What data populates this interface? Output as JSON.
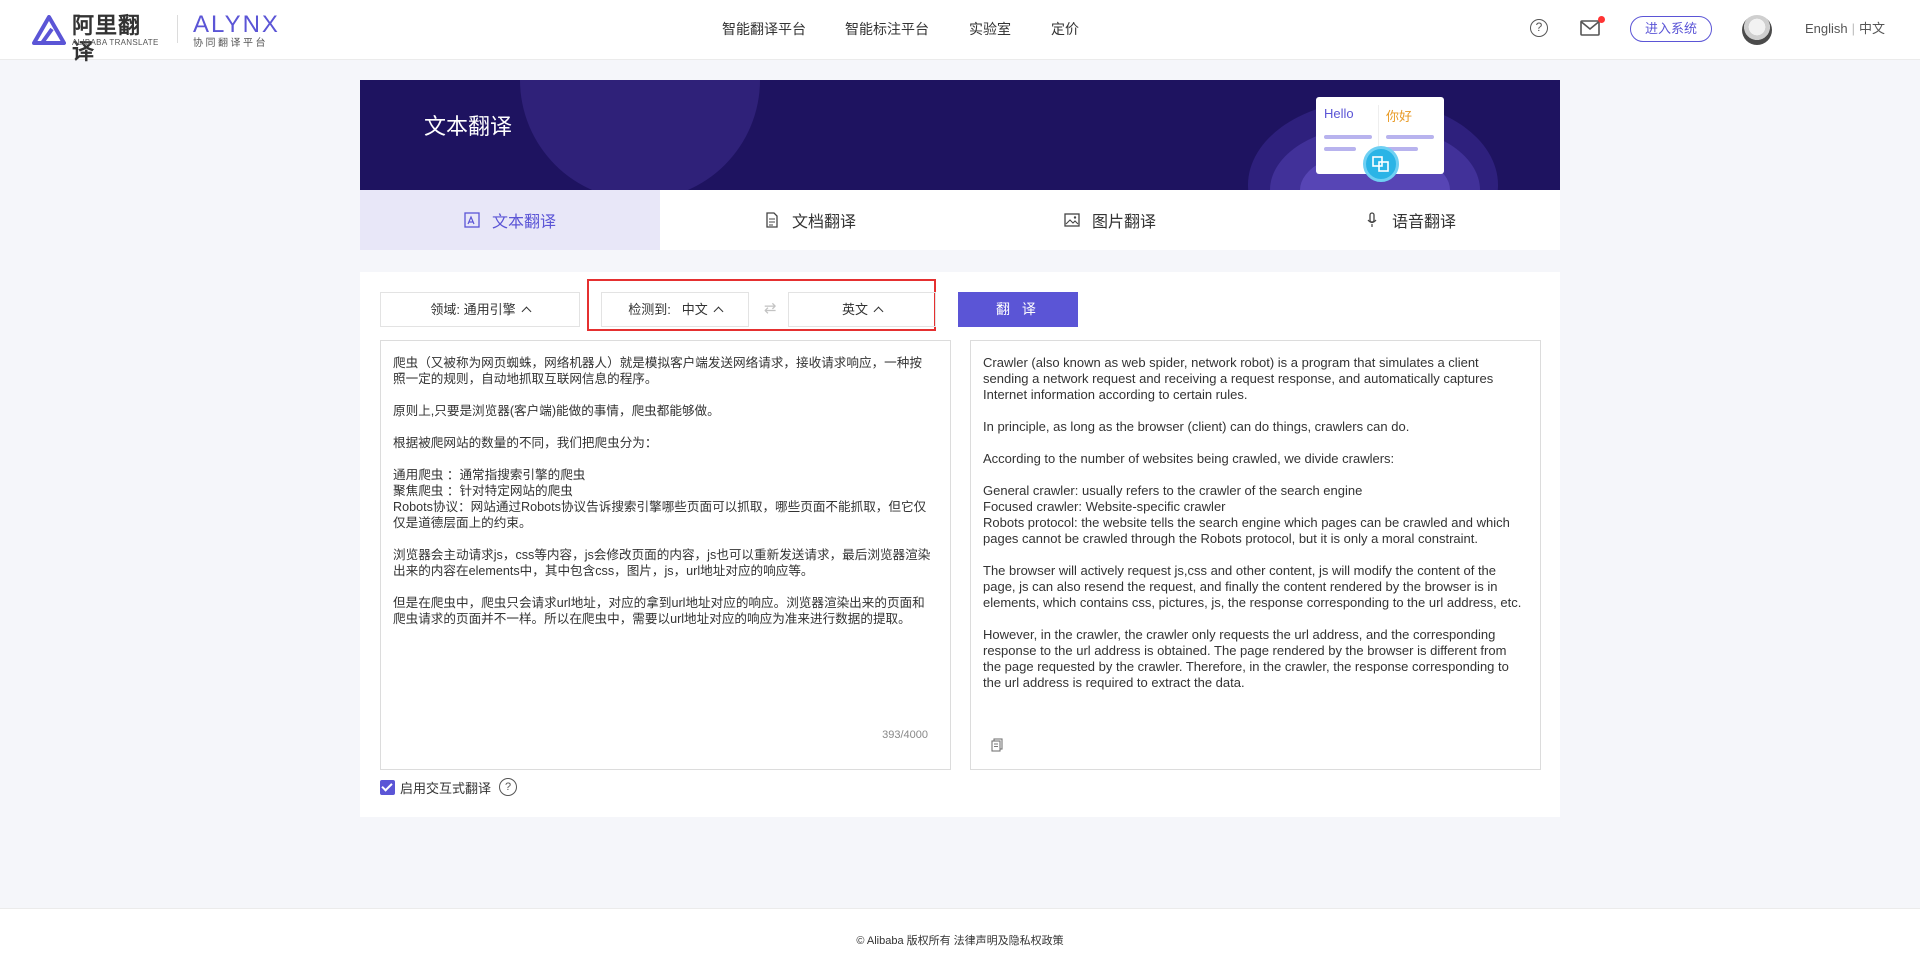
{
  "header": {
    "logo_name": "阿里翻译",
    "logo_sub": "ALIBABA TRANSLATE",
    "alynx_name": "ALYNX",
    "alynx_sub": "协同翻译平台",
    "nav": [
      "智能翻译平台",
      "智能标注平台",
      "实验室",
      "定价"
    ],
    "help": "?",
    "enter_button": "进入系统",
    "lang_en": "English",
    "lang_sep": "|",
    "lang_zh": "中文"
  },
  "banner": {
    "title": "文本翻译",
    "card_hello": "Hello",
    "card_nihao": "你好"
  },
  "tabs": [
    {
      "label": "文本翻译",
      "icon": "image-text-icon",
      "active": true
    },
    {
      "label": "文档翻译",
      "icon": "document-icon",
      "active": false
    },
    {
      "label": "图片翻译",
      "icon": "picture-icon",
      "active": false
    },
    {
      "label": "语音翻译",
      "icon": "microphone-icon",
      "active": false
    }
  ],
  "controls": {
    "domain": "领域: 通用引擎",
    "detect_label": "检测到:",
    "detect_value": "中文",
    "swap": "⇄",
    "target": "英文",
    "translate_button": "翻 译"
  },
  "source": {
    "paragraphs": [
      "爬虫（又被称为网页蜘蛛，网络机器人）就是模拟客户端发送网络请求，接收请求响应，一种按照一定的规则，自动地抓取互联网信息的程序。",
      "原则上,只要是浏览器(客户端)能做的事情，爬虫都能够做。",
      "根据被爬网站的数量的不同，我们把爬虫分为：",
      "通用爬虫 ：通常指搜索引擎的爬虫\n聚焦爬虫 ：针对特定网站的爬虫\nRobots协议：网站通过Robots协议告诉搜索引擎哪些页面可以抓取，哪些页面不能抓取，但它仅仅是道德层面上的约束。",
      "浏览器会主动请求js，css等内容，js会修改页面的内容，js也可以重新发送请求，最后浏览器渲染出来的内容在elements中，其中包含css，图片，js，url地址对应的响应等。",
      "但是在爬虫中，爬虫只会请求url地址，对应的拿到url地址对应的响应。浏览器渲染出来的页面和爬虫请求的页面并不一样。所以在爬虫中，需要以url地址对应的响应为准来进行数据的提取。"
    ],
    "char_count": "393/4000"
  },
  "target": {
    "paragraphs": [
      "Crawler (also known as web spider, network robot) is a program that simulates a client sending a network request and receiving a request response, and automatically captures Internet information according to certain rules.",
      "In principle, as long as the browser (client) can do things, crawlers can do.",
      "According to the number of websites being crawled, we divide crawlers:",
      "General crawler: usually refers to the crawler of the search engine\nFocused crawler: Website-specific crawler\nRobots protocol: the website tells the search engine which pages can be crawled and which pages cannot be crawled through the Robots protocol, but it is only a moral constraint.",
      "The browser will actively request js,css and other content, js will modify the content of the page, js can also resend the request, and finally the content rendered by the browser is in elements, which contains css, pictures, js, the response corresponding to the url address, etc.",
      "However, in the crawler, the crawler only requests the url address, and the corresponding response to the url address is obtained. The page rendered by the browser is different from the page requested by the crawler. Therefore, in the crawler, the response corresponding to the url address is required to extract the data."
    ]
  },
  "interactive_toggle": {
    "label": "启用交互式翻译",
    "checked": true,
    "help": "?"
  },
  "footer": {
    "text": "© Alibaba 版权所有 法律声明及隐私权政策"
  },
  "colors": {
    "accent": "#5b55d6",
    "banner_bg": "#1e1360",
    "highlight_border": "#e53030",
    "active_tab_bg": "#e8e7f8"
  }
}
